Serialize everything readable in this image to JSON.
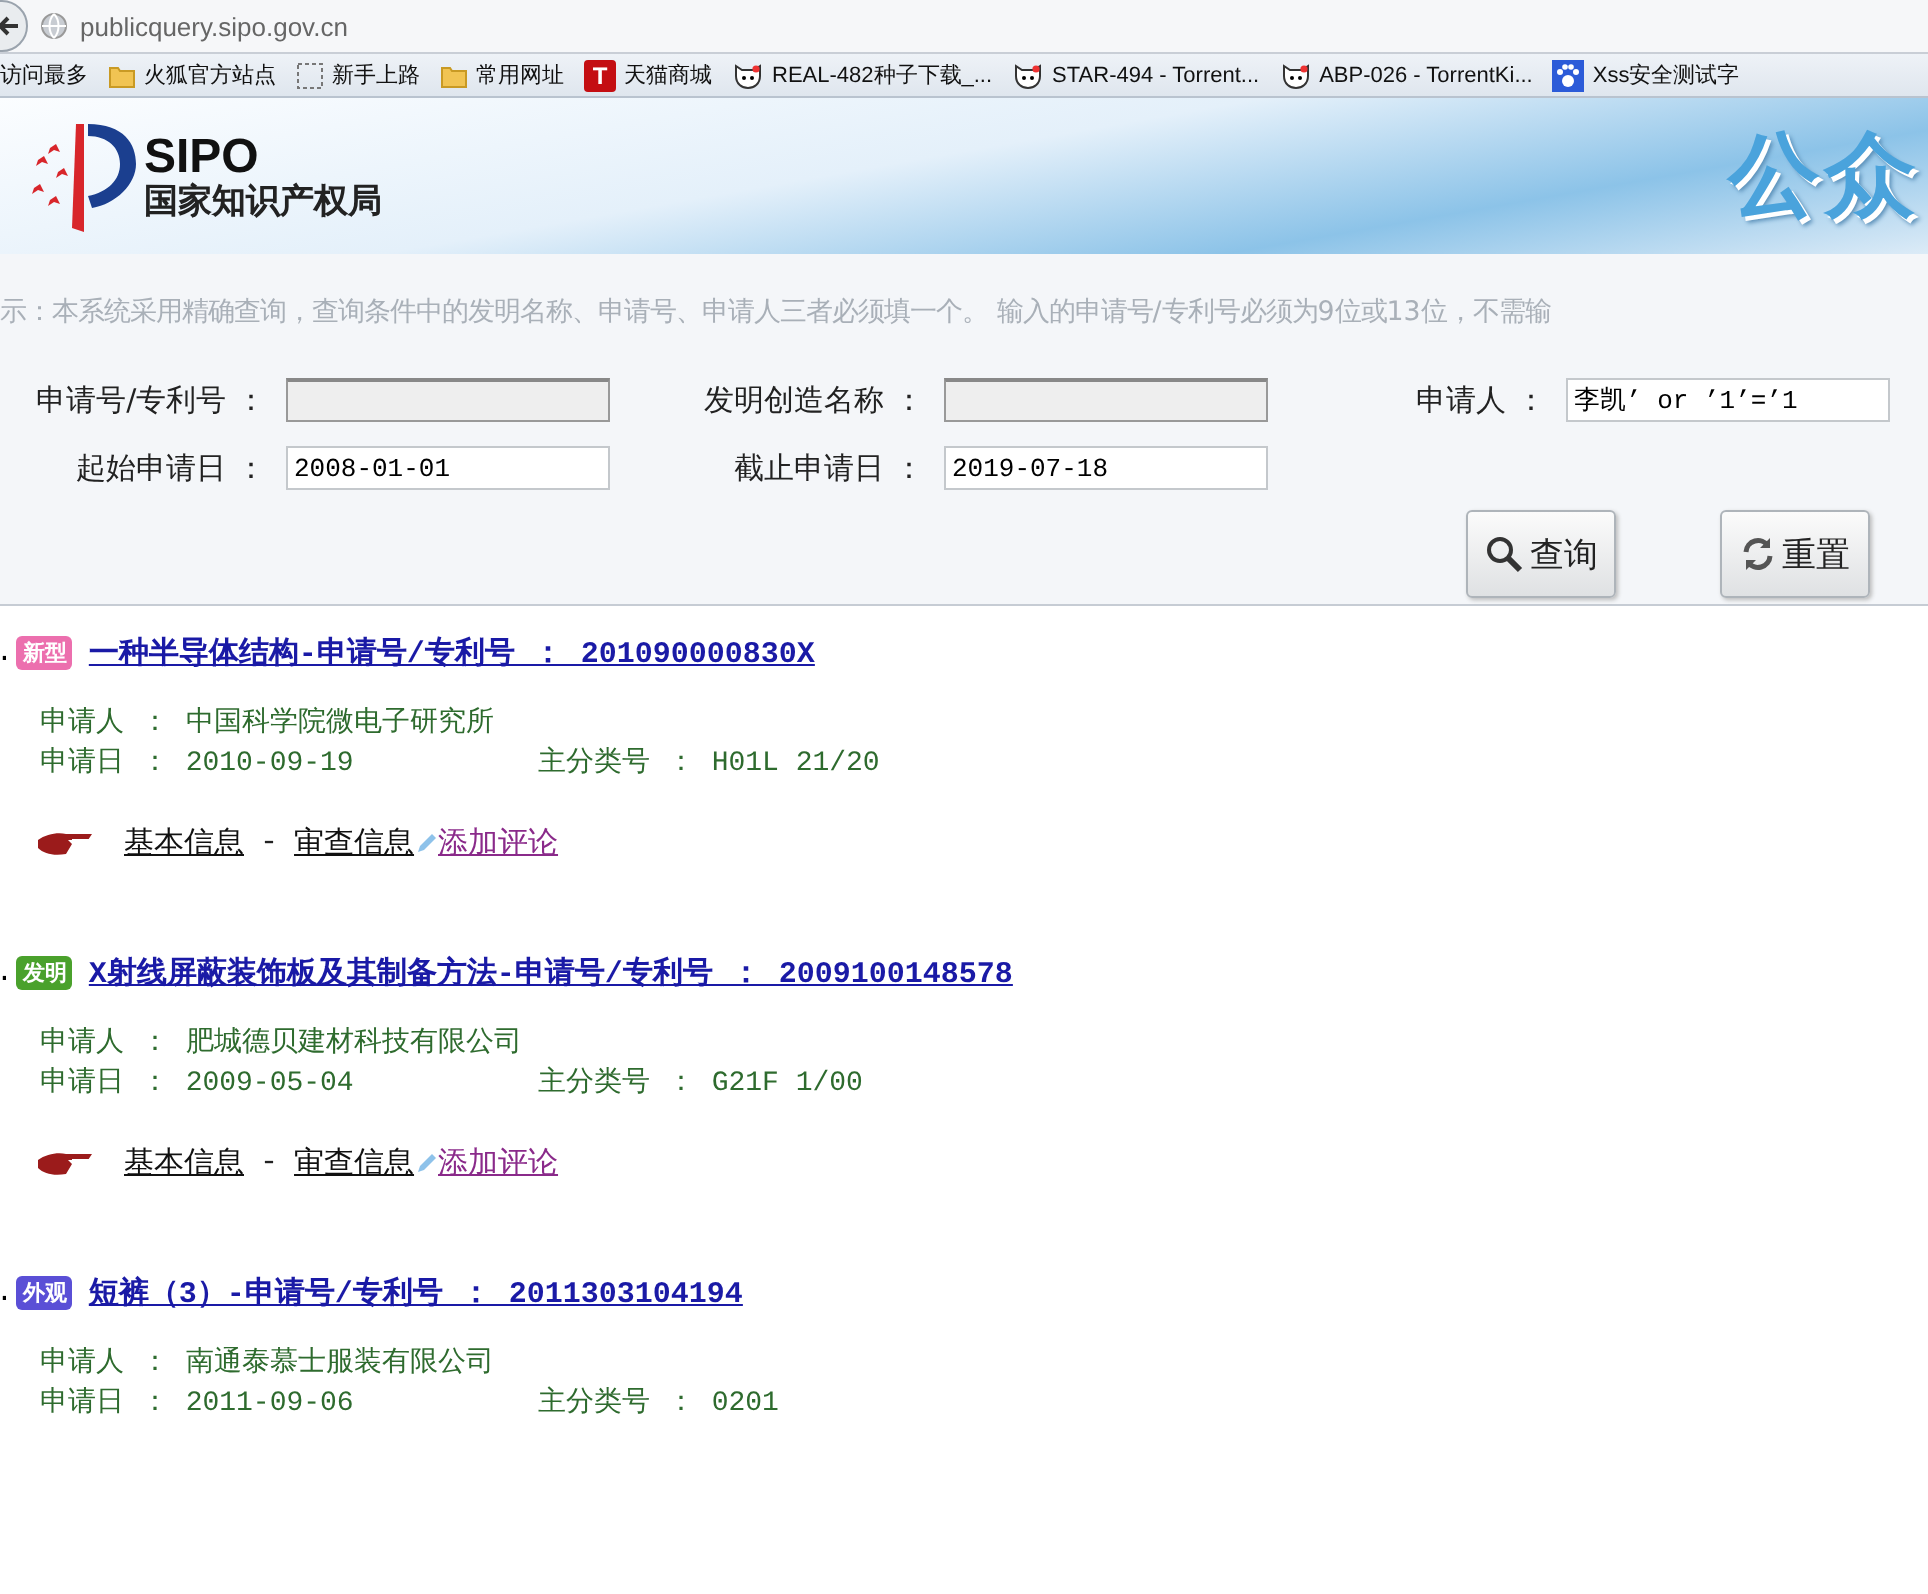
{
  "browser": {
    "address": "publicquery.sipo.gov.cn",
    "bookmarks": [
      {
        "label": "访问最多",
        "kind": "none"
      },
      {
        "label": "火狐官方站点",
        "kind": "folder"
      },
      {
        "label": "新手上路",
        "kind": "dotted"
      },
      {
        "label": "常用网址",
        "kind": "folder"
      },
      {
        "label": "天猫商城",
        "kind": "tmall",
        "glyph": "T"
      },
      {
        "label": "REAL-482种子下载_...",
        "kind": "kitty"
      },
      {
        "label": "STAR-494 - Torrent...",
        "kind": "kitty"
      },
      {
        "label": "ABP-026 - TorrentKi...",
        "kind": "kitty"
      },
      {
        "label": "Xss安全测试字",
        "kind": "paw"
      }
    ]
  },
  "banner": {
    "logo": "SIPO",
    "org": "国家知识产权局",
    "title": "公众"
  },
  "hint": "示：本系统采用精确查询，查询条件中的发明名称、申请号、申请人三者必须填一个。 输入的申请号/专利号必须为9位或13位，不需输",
  "form": {
    "rows": [
      [
        {
          "label": "申请号/专利号 ：",
          "disabled": true
        },
        {
          "label": "发明创造名称 ：",
          "disabled": true
        },
        {
          "label": "申请人 ：",
          "value": "李凯’ or ’1’=’1",
          "disabled": false
        }
      ],
      [
        {
          "label": "起始申请日 ：",
          "value": "2008-01-01",
          "disabled": false
        },
        {
          "label": "截止申请日 ：",
          "value": "2019-07-18",
          "disabled": false
        }
      ]
    ],
    "buttons": [
      {
        "label": "查询",
        "kind": "search"
      },
      {
        "label": "重置",
        "kind": "reset"
      }
    ]
  },
  "results": [
    {
      "index": ".",
      "badge": "新型",
      "color": "#ec6fae",
      "title": "一种半导体结构-申请号/专利号 ： 201090000830X",
      "applicant_label": "申请人 ：",
      "applicant": "中国科学院微电子研究所",
      "date_label": "申请日 ：",
      "date": "2010-09-19",
      "class_label": "主分类号 ：",
      "class": "H01L 21/20",
      "links": {
        "basic": "基本信息",
        "sep": "-",
        "exam": "审查信息",
        "comment": "添加评论"
      }
    },
    {
      "index": ".",
      "badge": "发明",
      "color": "#4aa12c",
      "title": "X射线屏蔽装饰板及其制备方法-申请号/专利号 ： 2009100148578",
      "applicant_label": "申请人 ：",
      "applicant": "肥城德贝建材科技有限公司",
      "date_label": "申请日 ：",
      "date": "2009-05-04",
      "class_label": "主分类号 ：",
      "class": "G21F 1/00",
      "links": {
        "basic": "基本信息",
        "sep": "-",
        "exam": "审查信息",
        "comment": "添加评论"
      }
    },
    {
      "index": ".",
      "badge": "外观",
      "color": "#5a4fd6",
      "title": "短裤（3）-申请号/专利号 ： 2011303104194",
      "applicant_label": "申请人 ：",
      "applicant": "南通泰慕士服装有限公司",
      "date_label": "申请日 ：",
      "date": "2011-09-06",
      "class_label": "主分类号 ：",
      "class": "0201"
    }
  ]
}
